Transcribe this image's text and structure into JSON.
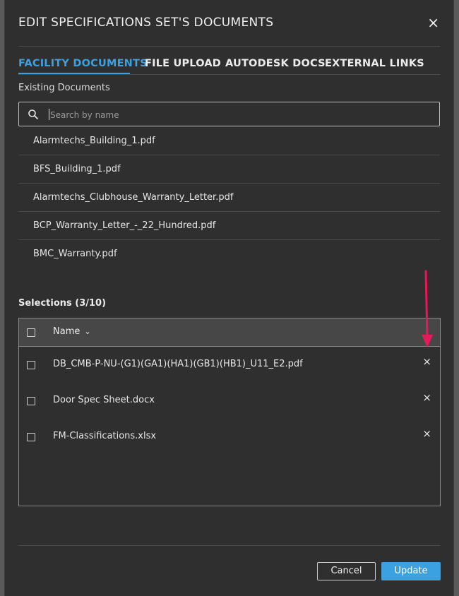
{
  "dialog": {
    "title": "EDIT SPECIFICATIONS SET'S DOCUMENTS",
    "close_label": "×"
  },
  "tabs": [
    {
      "label": "FACILITY DOCUMENTS",
      "active": true
    },
    {
      "label": "FILE UPLOAD",
      "active": false
    },
    {
      "label": "AUTODESK DOCS",
      "active": false
    },
    {
      "label": "EXTERNAL LINKS",
      "active": false
    }
  ],
  "existing": {
    "label": "Existing Documents",
    "search_placeholder": "Search by name",
    "items": [
      "Alarmtechs_Building_1.pdf",
      "BFS_Building_1.pdf",
      "Alarmtechs_Clubhouse_Warranty_Letter.pdf",
      "BCP_Warranty_Letter_-_22_Hundred.pdf",
      "BMC_Warranty.pdf"
    ]
  },
  "selections": {
    "label": "Selections (3/10)",
    "column_name": "Name",
    "remove_label": "×",
    "rows": [
      "DB_CMB-P-NU-(G1)(GA1)(HA1)(GB1)(HB1)_U11_E2.pdf",
      "Door Spec Sheet.docx",
      "FM-Classifications.xlsx"
    ]
  },
  "footer": {
    "cancel_label": "Cancel",
    "update_label": "Update"
  },
  "colors": {
    "accent": "#3ba1e0",
    "background": "#2f2f2f",
    "annotation_arrow": "#e8185a"
  },
  "icons": {
    "search": "search-icon",
    "close": "close-icon",
    "sort": "chevron-down-icon",
    "annotation": "arrow-down-icon"
  }
}
